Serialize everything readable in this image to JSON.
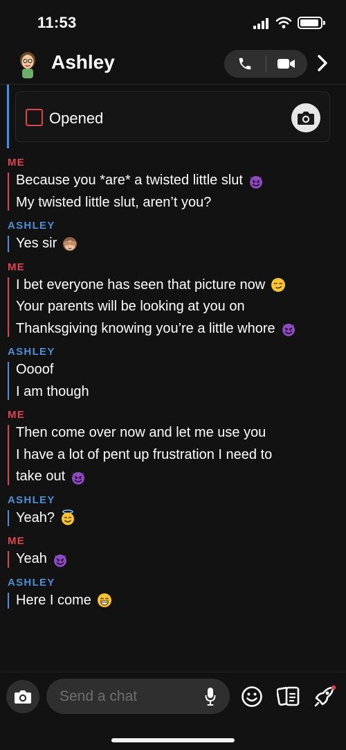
{
  "status_bar": {
    "time": "11:53"
  },
  "header": {
    "contact_name": "Ashley"
  },
  "opened_card": {
    "label": "Opened"
  },
  "messages": [
    {
      "sender": "ME",
      "lines": [
        {
          "text": "Because you *are* a twisted little slut",
          "emoji": "smiling-devil"
        },
        {
          "text": "My twisted little slut, aren’t you?"
        }
      ]
    },
    {
      "sender": "ASHLEY",
      "lines": [
        {
          "text": "Yes sir",
          "emoji": "see-no-evil-monkey"
        }
      ]
    },
    {
      "sender": "ME",
      "lines": [
        {
          "text": "I bet everyone has seen that picture now",
          "emoji": "smirk"
        },
        {
          "text": "Your parents will be looking at you on"
        },
        {
          "text": "Thanksgiving knowing you’re a little whore",
          "emoji": "smiling-devil"
        }
      ]
    },
    {
      "sender": "ASHLEY",
      "lines": [
        {
          "text": "Oooof"
        },
        {
          "text": "I am though"
        }
      ]
    },
    {
      "sender": "ME",
      "lines": [
        {
          "text": "Then come over now and let me use you"
        },
        {
          "text": "I have a lot of pent up frustration I need to"
        },
        {
          "text": "take out",
          "emoji": "smiling-devil"
        }
      ]
    },
    {
      "sender": "ASHLEY",
      "lines": [
        {
          "text": "Yeah?",
          "emoji": "halo-smile"
        }
      ]
    },
    {
      "sender": "ME",
      "lines": [
        {
          "text": "Yeah",
          "emoji": "smiling-devil"
        }
      ]
    },
    {
      "sender": "ASHLEY",
      "lines": [
        {
          "text": "Here I come",
          "emoji": "grin"
        }
      ]
    }
  ],
  "composer": {
    "placeholder": "Send a chat"
  },
  "colors": {
    "me": "#e0434f",
    "ashley": "#4d8fd8",
    "background": "#121212"
  }
}
